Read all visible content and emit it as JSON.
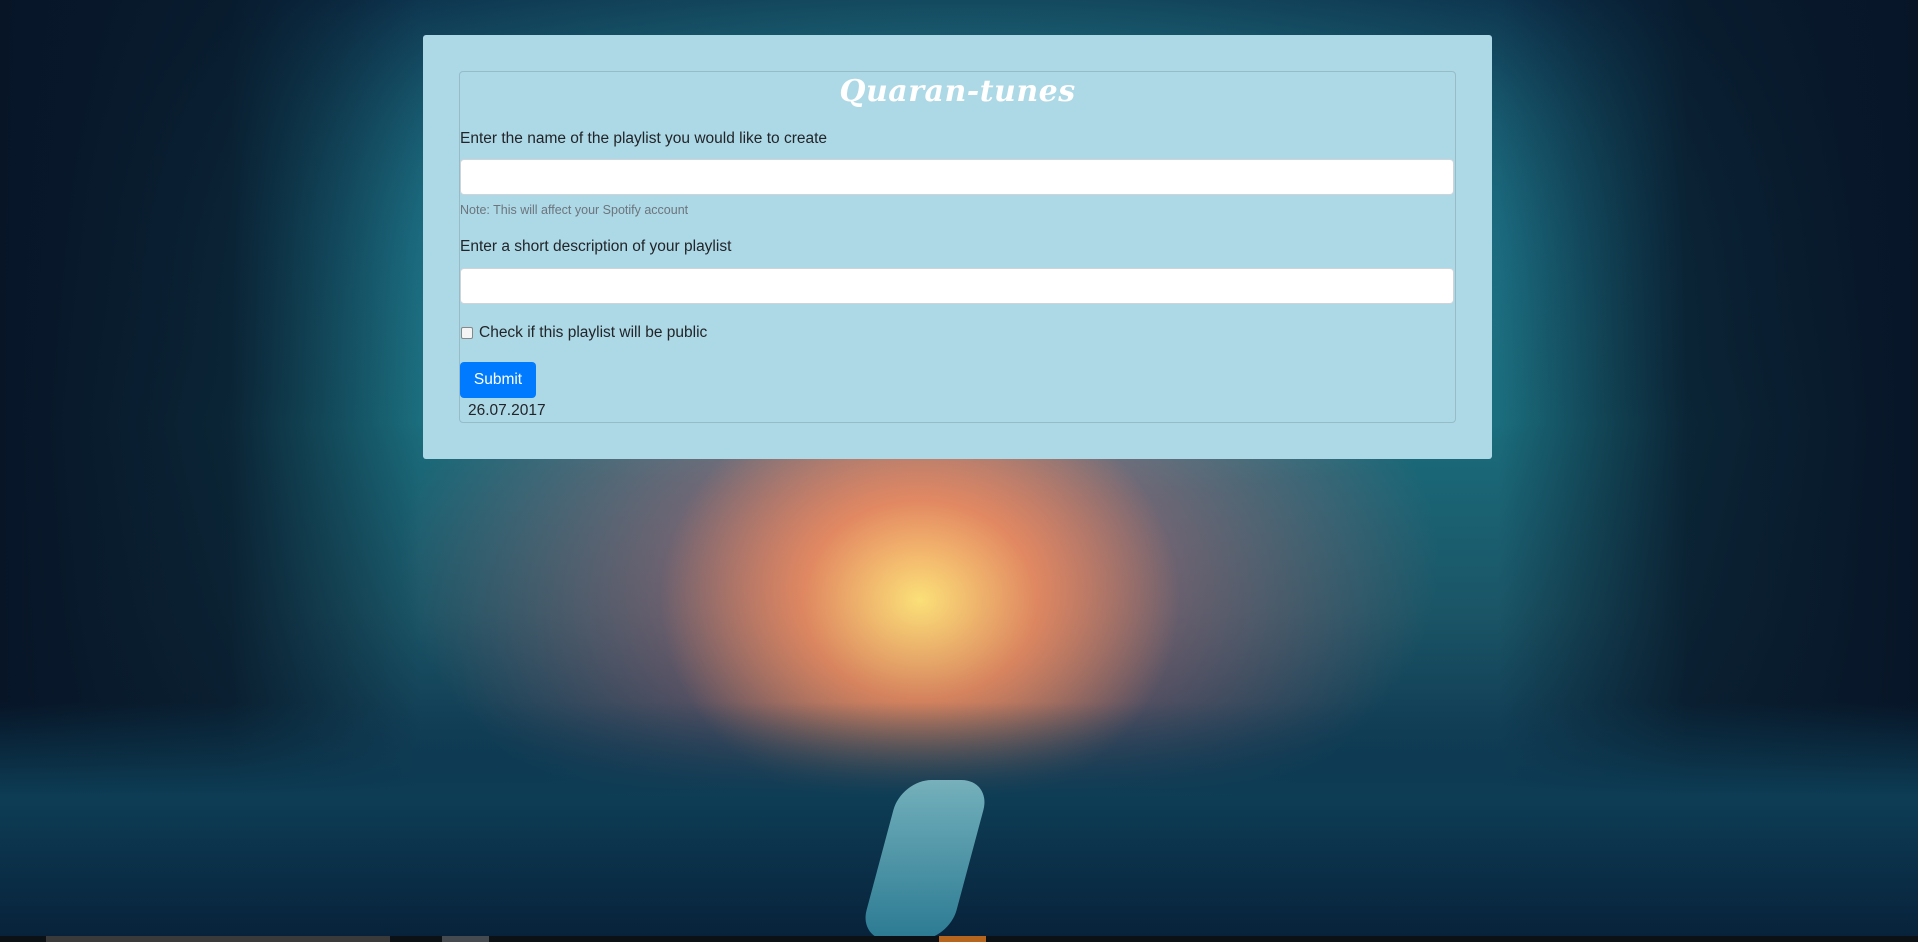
{
  "app": {
    "title": "Quaran-tunes"
  },
  "form": {
    "name_label": "Enter the name of the playlist you would like to create",
    "name_value": "",
    "name_note": "Note: This will affect your Spotify account",
    "description_label": "Enter a short description of your playlist",
    "description_value": "",
    "public_checkbox_label": "Check if this playlist will be public",
    "public_checked": false,
    "submit_label": "Submit",
    "date": "26.07.2017"
  },
  "colors": {
    "panel": "#add8e6",
    "submit": "#007bff"
  }
}
